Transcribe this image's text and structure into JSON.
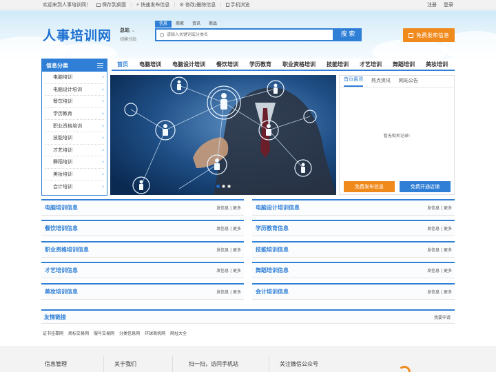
{
  "topbar": {
    "welcome": "欢迎来到人事培训网！",
    "links": [
      {
        "icon": "monitor-icon",
        "label": "保存到桌面"
      },
      {
        "icon": "bolt-icon",
        "label": "快速发布信息"
      },
      {
        "icon": "gear-icon",
        "label": "修改/删除信息"
      },
      {
        "icon": "mobile-icon",
        "label": "手机浏览"
      }
    ],
    "register": "注册",
    "login": "登录"
  },
  "header": {
    "logo": "人事培训网",
    "city": "总站",
    "city_sub": "切换分站",
    "search_tabs": [
      "信息",
      "商家",
      "资讯",
      "商品"
    ],
    "search_placeholder": "请输入关键词或分类名",
    "search_button": "搜 索",
    "publish_button": "免费发布信息"
  },
  "sidebar": {
    "title": "信息分类",
    "items": [
      "电脑培训",
      "电脑设计培训",
      "餐饮培训",
      "学历教育",
      "职业资格培训",
      "技能培训",
      "才艺培训",
      "舞蹈培训",
      "美妆培训",
      "会计培训"
    ]
  },
  "nav": [
    "首页",
    "电脑培训",
    "电脑设计培训",
    "餐饮培训",
    "学历教育",
    "职业资格培训",
    "技能培训",
    "才艺培训",
    "舞蹈培训",
    "美妆培训"
  ],
  "notice": {
    "tabs": [
      "首页置顶",
      "热点资讯",
      "网站公告"
    ],
    "empty_text": "暂无相关记录!",
    "btn_publish": "免费发布信息",
    "btn_shop": "免费开通店铺"
  },
  "sections": [
    {
      "title": "电脑培训信息",
      "links": "发信息 | 更多"
    },
    {
      "title": "电脑设计培训信息",
      "links": "发信息 | 更多"
    },
    {
      "title": "餐饮培训信息",
      "links": "发信息 | 更多"
    },
    {
      "title": "学历教育信息",
      "links": "发信息 | 更多"
    },
    {
      "title": "职业资格培训信息",
      "links": "发信息 | 更多"
    },
    {
      "title": "技能培训信息",
      "links": "发信息 | 更多"
    },
    {
      "title": "才艺培训信息",
      "links": "发信息 | 更多"
    },
    {
      "title": "舞蹈培训信息",
      "links": "发信息 | 更多"
    },
    {
      "title": "美妆培训信息",
      "links": "发信息 | 更多"
    },
    {
      "title": "会计培训信息",
      "links": "发信息 | 更多"
    }
  ],
  "friend": {
    "title": "友情链接",
    "apply": "我要申请",
    "links": [
      "证书挂靠网",
      "商标交易网",
      "服号交易网",
      "分类信息网",
      "环球商机网",
      "网址大全"
    ]
  },
  "footer": {
    "cols": [
      "信息管理",
      "关于我们",
      "扫一扫，访问手机站",
      "关注微信公众号"
    ]
  },
  "colors": {
    "primary": "#2f7fd6",
    "accent": "#f08a1c"
  }
}
